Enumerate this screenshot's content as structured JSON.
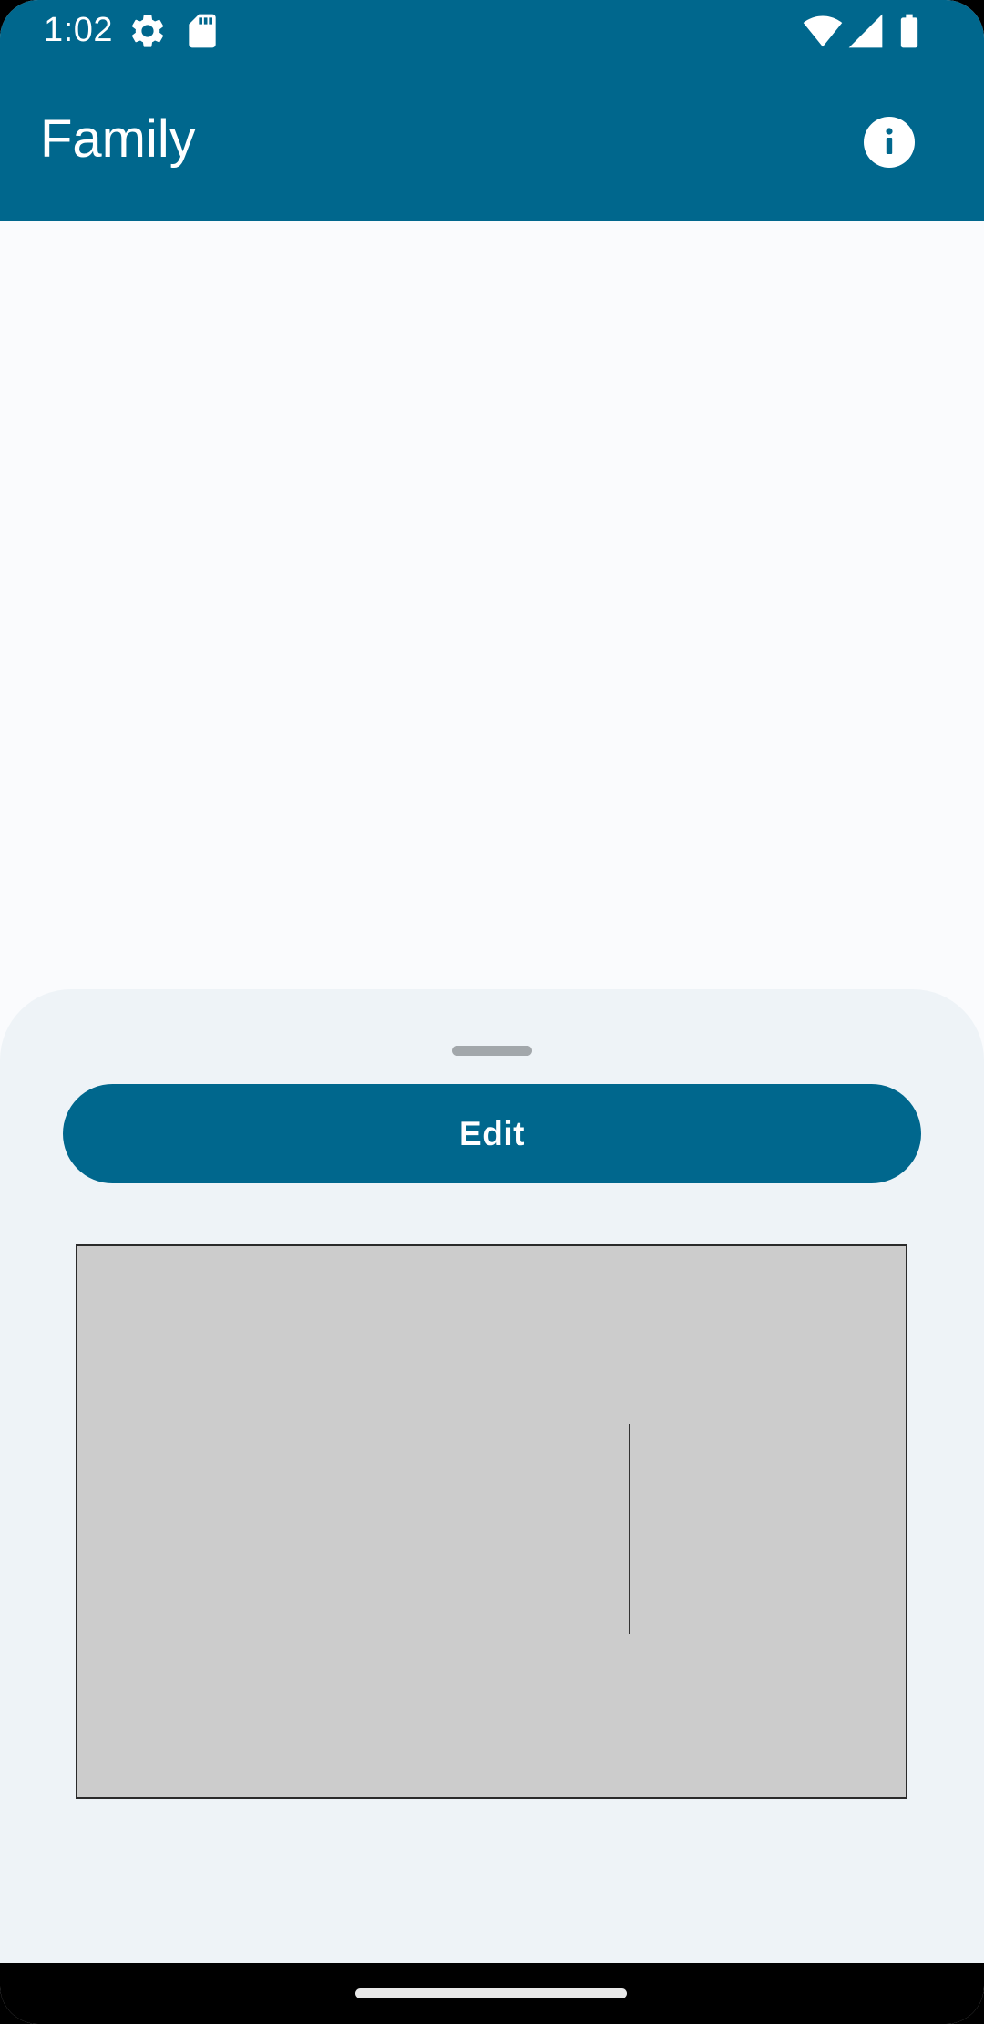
{
  "status_bar": {
    "time": "1:02",
    "icons": [
      "settings-gear-icon",
      "sd-card-icon",
      "wifi-icon",
      "cellular-signal-icon",
      "battery-icon"
    ]
  },
  "app_bar": {
    "title": "Family",
    "info_icon": "info-icon"
  },
  "bottom_sheet": {
    "edit_label": "Edit"
  },
  "colors": {
    "primary": "#00678d",
    "background": "#fafbfd",
    "sheet": "#eef3f7",
    "canvas": "#cccccc"
  }
}
